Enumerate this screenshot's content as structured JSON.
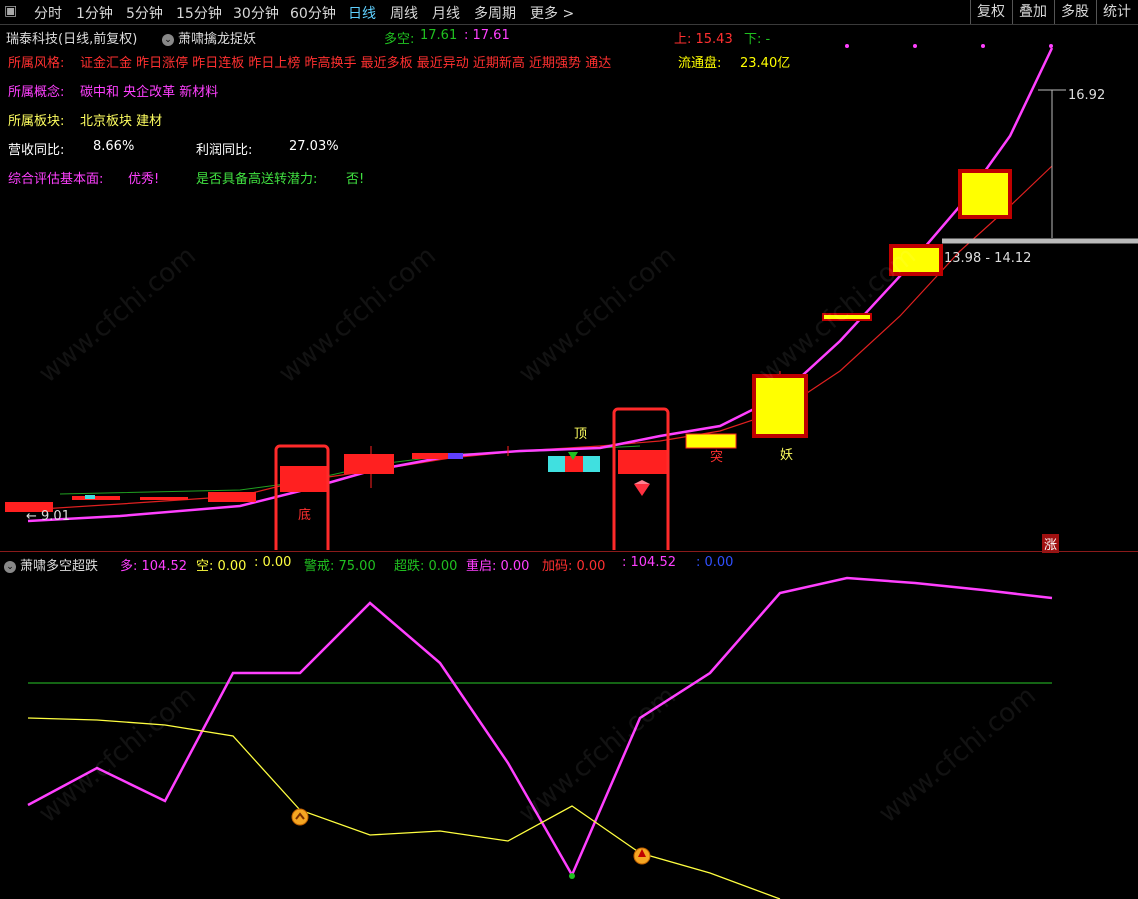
{
  "toolbar": {
    "periods": [
      "分时",
      "1分钟",
      "5分钟",
      "15分钟",
      "30分钟",
      "60分钟",
      "日线",
      "周线",
      "月线",
      "多周期",
      "更多 >"
    ],
    "active_period": "日线",
    "right_buttons": [
      "复权",
      "叠加",
      "多股",
      "统计"
    ]
  },
  "main": {
    "title": "瑞泰科技(日线,前复权)",
    "indicator_name": "萧啸擒龙捉妖",
    "duokong_label": "多空:",
    "duokong_value1": "17.61",
    "duokong_value2": ": 17.61",
    "up_label": "上: 15.43",
    "down_label": "下: -",
    "style_label": "所属风格:",
    "style_value": "证金汇金 昨日涨停 昨日连板 昨日上榜 昨高换手 最近多板 最近异动 近期新高 近期强势 通达",
    "float_label": "流通盘:",
    "float_value": "23.40亿",
    "concept_label": "所属概念:",
    "concept_value": "碳中和 央企改革 新材料",
    "sector_label": "所属板块:",
    "sector_value": "北京板块 建材",
    "revenue_label": "营收同比:",
    "revenue_value": "8.66%",
    "profit_label": "利润同比:",
    "profit_value": "27.03%",
    "eval_label": "综合评估基本面:",
    "eval_value": "优秀!",
    "transfer_label": "是否具备高送转潜力:",
    "transfer_value": "否!",
    "annotations": {
      "high": "16.92",
      "range": "13.98 - 14.12",
      "low": "9.01",
      "top_tag": "顶",
      "low_tag": "底",
      "break_tag": "突",
      "demon_tag": "妖",
      "zhang_tag": "涨"
    }
  },
  "sub": {
    "title": "萧啸多空超跌",
    "duo_label": "多: 104.52",
    "kong_label": "空: 0.00",
    "kong2_label": ": 0.00",
    "warn_label": "警戒: 75.00",
    "chaodie_label": "超跌: 0.00",
    "restart_label": "重启: 0.00",
    "jiama_label": "加码: 0.00",
    "extra1": ": 104.52",
    "extra2": ": 0.00"
  },
  "watermark": "www.cfchi.com",
  "colors": {
    "up": "#ff2020",
    "down": "#40e0e0",
    "yellow": "#ffff00",
    "magenta": "#ff40ff",
    "green": "#20c020",
    "highlight": "#ff2a2a"
  }
}
